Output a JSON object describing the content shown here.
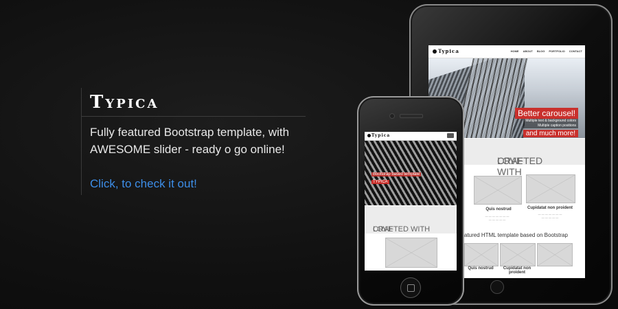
{
  "hero": {
    "title": "Typica",
    "description": "Fully featured Bootstrap template, with AWESOME slider - ready o go online!",
    "link": "Click, to check it out!"
  },
  "tablet": {
    "logo": "Typica",
    "menu": [
      "HOME",
      "ABOUT",
      "BLOG",
      "PORTFOLIO",
      "CONTACT"
    ],
    "caption1": "Better carousel!",
    "caption2a": "Multiple text & background colors",
    "caption2b": "Multiple caption positions",
    "caption3": "and much more!",
    "crafted_a": "CRAFTED WITH",
    "crafted_b": "LOVE",
    "items": [
      {
        "title": "Quis nostrud"
      },
      {
        "title": "Cupidatat non proident"
      }
    ],
    "featured": "atured HTML template based on Bootstrap",
    "items2": [
      {
        "title": "Quis nostrud"
      },
      {
        "title": "Cupidatat non proident"
      }
    ]
  },
  "phone": {
    "logo": "Typica",
    "caption1": "Bootstrap based template",
    "caption2": "TYPICA",
    "crafted_a": "CRAFTED WITH",
    "crafted_b": "LOVE"
  },
  "colors": {
    "accent_link": "#3d8ee8",
    "accent_red": "#c9302c"
  }
}
